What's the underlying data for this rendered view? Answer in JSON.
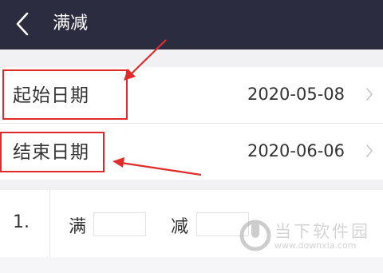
{
  "header": {
    "title": "满减",
    "back_icon": "chevron-left-icon"
  },
  "start_date": {
    "label": "起始日期",
    "value": "2020-05-08",
    "icon": "chevron-right-icon"
  },
  "end_date": {
    "label": "结束日期",
    "value": "2020-06-06",
    "icon": "chevron-right-icon"
  },
  "rule": {
    "index": "1.",
    "full_label": "满",
    "full_value": "",
    "reduce_label": "减",
    "reduce_value": ""
  },
  "watermark": {
    "text": "当下软件园",
    "url": "www.downxia.com"
  },
  "colors": {
    "header_bg": "#2c2c40",
    "annotation_red": "#e02b2b",
    "section_gap": "#f1f1f4"
  }
}
